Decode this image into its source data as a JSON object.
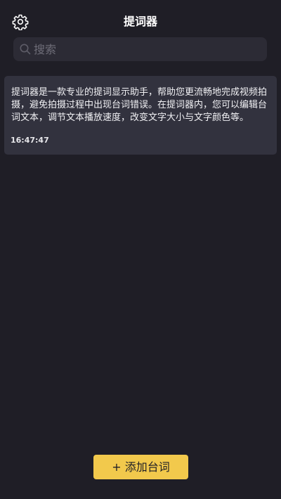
{
  "header": {
    "title": "提词器",
    "settings_icon": "gear-icon"
  },
  "search": {
    "placeholder": "搜索",
    "value": "",
    "icon": "search-icon"
  },
  "scripts": [
    {
      "text": "提词器是一款专业的提词显示助手，帮助您更流畅地完成视频拍摄，避免拍摄过程中出现台词错误。在提词器内，您可以编辑台词文本，调节文本播放速度，改变文字大小与文字颜色等。",
      "time": "16:47:47"
    }
  ],
  "footer": {
    "add_label": "+ 添加台词"
  },
  "colors": {
    "background": "#1f1e26",
    "card": "#32323e",
    "search_bg": "#2c2b35",
    "accent": "#f2c94c"
  }
}
